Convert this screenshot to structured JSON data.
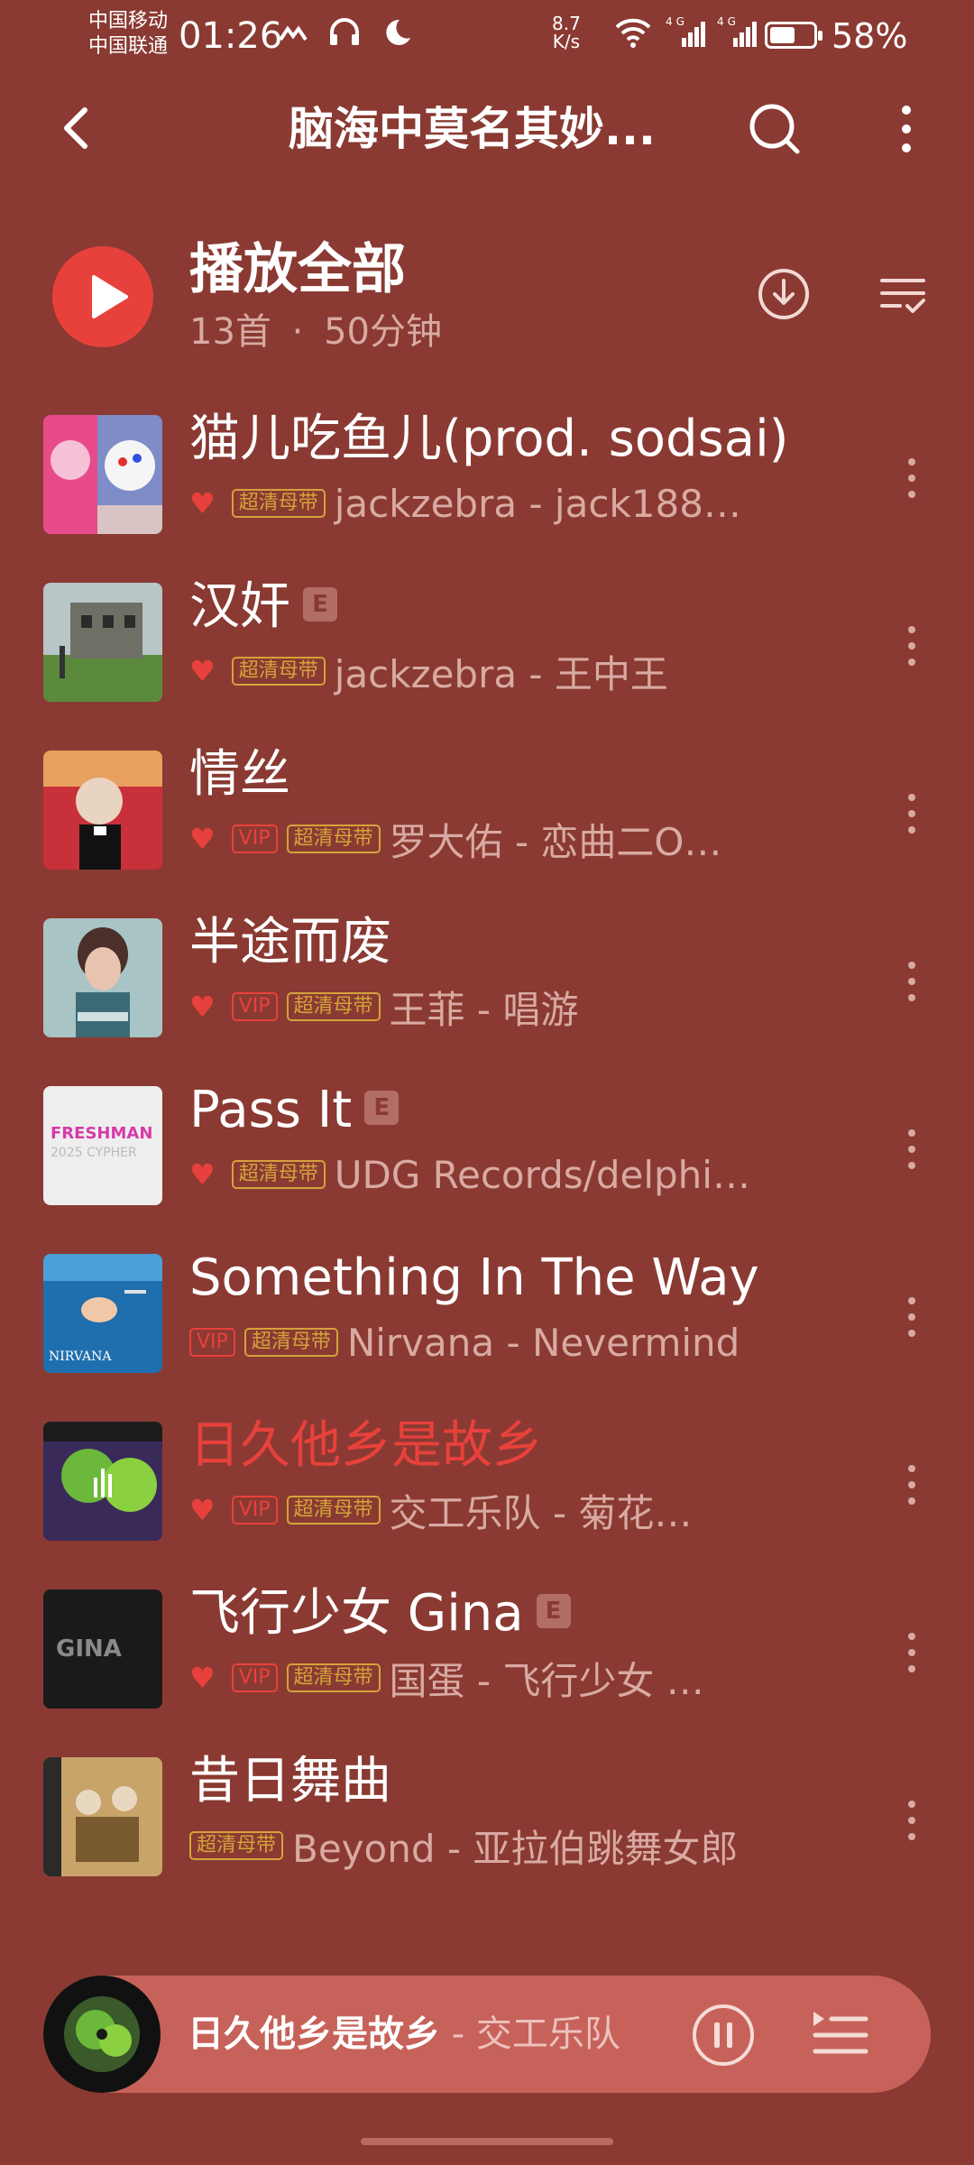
{
  "status": {
    "carrier1": "中国移动",
    "carrier2": "中国联通",
    "time": "01:26",
    "net_speed_value": "8.7",
    "net_speed_unit": "K/s",
    "signal_icons": "4G 4G",
    "battery_level": 0.58,
    "battery_percent": "58%"
  },
  "header": {
    "title": "脑海中莫名其妙...",
    "back_icon": "chevron-left-icon",
    "search_icon": "search-icon",
    "more_icon": "more-vertical-icon"
  },
  "play_all": {
    "label": "播放全部",
    "count": "13首",
    "separator": "·",
    "duration": "50分钟",
    "download_icon": "download-icon",
    "manage_icon": "list-check-icon"
  },
  "songs": [
    {
      "title": "猫儿吃鱼儿(prod. sodsai)",
      "artist_album": "jackzebra - jack188…",
      "liked": true,
      "vip": false,
      "hq": true,
      "explicit": false,
      "playing": false
    },
    {
      "title": "汉奸",
      "artist_album": "jackzebra - 王中王",
      "liked": true,
      "vip": false,
      "hq": true,
      "explicit": true,
      "playing": false
    },
    {
      "title": "情丝",
      "artist_album": "罗大佑 - 恋曲二O…",
      "liked": true,
      "vip": true,
      "hq": true,
      "explicit": false,
      "playing": false
    },
    {
      "title": "半途而废",
      "artist_album": "王菲 - 唱游",
      "liked": true,
      "vip": true,
      "hq": true,
      "explicit": false,
      "playing": false
    },
    {
      "title": "Pass It",
      "artist_album": "UDG Records/delphi…",
      "liked": true,
      "vip": false,
      "hq": true,
      "explicit": true,
      "playing": false
    },
    {
      "title": "Something In The Way",
      "artist_album": "Nirvana - Nevermind",
      "liked": false,
      "vip": true,
      "hq": true,
      "explicit": false,
      "playing": false
    },
    {
      "title": "日久他乡是故乡",
      "artist_album": "交工乐队 - 菊花…",
      "liked": true,
      "vip": true,
      "hq": true,
      "explicit": false,
      "playing": true
    },
    {
      "title": "飞行少女 Gina",
      "artist_album": "国蛋 - 飞行少女 …",
      "liked": true,
      "vip": true,
      "hq": true,
      "explicit": true,
      "playing": false
    },
    {
      "title": "昔日舞曲",
      "artist_album": "Beyond - 亚拉伯跳舞女郎",
      "liked": false,
      "vip": false,
      "hq": true,
      "explicit": false,
      "playing": false
    }
  ],
  "tags": {
    "vip": "VIP",
    "hq": "超清母带",
    "explicit": "E",
    "heart": "♥"
  },
  "cover_text": {
    "pass_it_line1": "FRESHMAN",
    "pass_it_line2": "2025 CYPHER",
    "nirvana": "NIRVANA",
    "gina": "GINA"
  },
  "player": {
    "song": "日久他乡是故乡",
    "artist": " - 交工乐队",
    "pause_icon": "pause-icon",
    "playlist_icon": "playlist-icon"
  },
  "colors": {
    "background": "#8a3a32",
    "accent": "#e8413c",
    "hq_tag": "#d4a33b",
    "secondary_text": "#d8aaa3",
    "player_bar": "#c7625a"
  }
}
